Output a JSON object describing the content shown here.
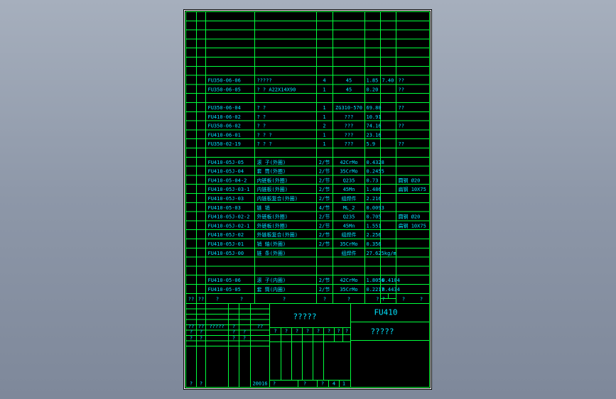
{
  "drawing": {
    "title_code": "FU410",
    "name_placeholder": "?????",
    "name_placeholder2": "?????",
    "year": "20016"
  },
  "rows": [
    {
      "code": "",
      "name": "",
      "qty": "",
      "material": "",
      "unit_weight": "",
      "total_weight": "",
      "note": ""
    },
    {
      "code": "",
      "name": "",
      "qty": "",
      "material": "",
      "unit_weight": "",
      "total_weight": "",
      "note": ""
    },
    {
      "code": "",
      "name": "",
      "qty": "",
      "material": "",
      "unit_weight": "",
      "total_weight": "",
      "note": ""
    },
    {
      "code": "",
      "name": "",
      "qty": "",
      "material": "",
      "unit_weight": "",
      "total_weight": "",
      "note": ""
    },
    {
      "code": "",
      "name": "",
      "qty": "",
      "material": "",
      "unit_weight": "",
      "total_weight": "",
      "note": ""
    },
    {
      "code": "",
      "name": "",
      "qty": "",
      "material": "",
      "unit_weight": "",
      "total_weight": "",
      "note": ""
    },
    {
      "code": "",
      "name": "",
      "qty": "",
      "material": "",
      "unit_weight": "",
      "total_weight": "",
      "note": ""
    },
    {
      "code": "FU350-06-06",
      "name": "?????",
      "qty": "4",
      "material": "45",
      "unit_weight": "1.85",
      "total_weight": "7.40",
      "note": "??"
    },
    {
      "code": "FU350-06-05",
      "name": "?  ?  A22X14X90",
      "qty": "1",
      "material": "45",
      "unit_weight": "0.20",
      "total_weight": "",
      "note": "??"
    },
    {
      "code": "",
      "name": "",
      "qty": "",
      "material": "",
      "unit_weight": "",
      "total_weight": "",
      "note": ""
    },
    {
      "code": "FU350-06-04",
      "name": "?      ?",
      "qty": "1",
      "material": "ZG310-570",
      "unit_weight": "69.80",
      "total_weight": "",
      "note": "??"
    },
    {
      "code": "FU410-06-02",
      "name": "?      ?",
      "qty": "1",
      "material": "???",
      "unit_weight": "10.91",
      "total_weight": "",
      "note": ""
    },
    {
      "code": "FU350-06-02",
      "name": "?      ?",
      "qty": "2",
      "material": "???",
      "unit_weight": "74.16",
      "total_weight": "",
      "note": "??"
    },
    {
      "code": "FU410-06-01",
      "name": "?   ?   ?",
      "qty": "1",
      "material": "???",
      "unit_weight": "23.16",
      "total_weight": "",
      "note": ""
    },
    {
      "code": "FU350-02-19",
      "name": "?   ?   ?",
      "qty": "1",
      "material": "???",
      "unit_weight": "5.9",
      "total_weight": "",
      "note": "??"
    },
    {
      "code": "",
      "name": "",
      "qty": "",
      "material": "",
      "unit_weight": "",
      "total_weight": "",
      "note": ""
    },
    {
      "code": "FU410-05J-05",
      "name": "滚 子(外圈)",
      "qty": "2/节",
      "material": "42CrMo",
      "unit_weight": "0.4328",
      "total_weight": "",
      "note": ""
    },
    {
      "code": "FU410-05J-04",
      "name": "套 筒(外圈)",
      "qty": "2/节",
      "material": "35CrMo",
      "unit_weight": "0.2455",
      "total_weight": "",
      "note": ""
    },
    {
      "code": "FU410-05-04-2",
      "name": "内链板(外圈)",
      "qty": "2/节",
      "material": "Q235",
      "unit_weight": "0.73",
      "total_weight": "",
      "note": "圆钢 Ø20"
    },
    {
      "code": "FU410-05J-03-1",
      "name": "内链板(外圈)",
      "qty": "2/节",
      "material": "45Mn",
      "unit_weight": "1.486",
      "total_weight": "",
      "note": "扁钢 10X75"
    },
    {
      "code": "FU410-05J-03",
      "name": "内链板复合(外圈)",
      "qty": "2/节",
      "material": "组焊件",
      "unit_weight": "2.216",
      "total_weight": "",
      "note": ""
    },
    {
      "code": "FU410-05-03",
      "name": "链 销",
      "qty": "4/节",
      "material": "ML_2",
      "unit_weight": "0.0093",
      "total_weight": "",
      "note": ""
    },
    {
      "code": "FU410-05J-02-2",
      "name": "外链板(外圈)",
      "qty": "2/节",
      "material": "Q235",
      "unit_weight": "0.705",
      "total_weight": "",
      "note": "圆钢 Ø20"
    },
    {
      "code": "FU410-05J-02-1",
      "name": "外链板(外圈)",
      "qty": "2/节",
      "material": "45Mn",
      "unit_weight": "1.551",
      "total_weight": "",
      "note": "扁钢 10X75"
    },
    {
      "code": "FU410-05J-02",
      "name": "外链板复合(外圈)",
      "qty": "2/节",
      "material": "组焊件",
      "unit_weight": "2.256",
      "total_weight": "",
      "note": ""
    },
    {
      "code": "FU410-05J-01",
      "name": "销 轴(外圈)",
      "qty": "2/节",
      "material": "35CrMo",
      "unit_weight": "0.356",
      "total_weight": "",
      "note": ""
    },
    {
      "code": "FU410-05J-00",
      "name": "链 条(外圈)",
      "qty": "",
      "material": "组焊件",
      "unit_weight": "27.625kg/m",
      "total_weight": "",
      "note": ""
    },
    {
      "code": "",
      "name": "",
      "qty": "",
      "material": "",
      "unit_weight": "",
      "total_weight": "",
      "note": ""
    },
    {
      "code": "",
      "name": "",
      "qty": "",
      "material": "",
      "unit_weight": "",
      "total_weight": "",
      "note": ""
    },
    {
      "code": "FU410-05-06",
      "name": "滚 子(内圈)",
      "qty": "2/节",
      "material": "42CrMo",
      "unit_weight": "1.8056",
      "total_weight": "0.4104",
      "note": ""
    },
    {
      "code": "FU410-05-05",
      "name": "套 筒(内圈)",
      "qty": "2/节",
      "material": "35CrMo",
      "unit_weight": "0.2217",
      "total_weight": "0.4434",
      "note": ""
    }
  ],
  "header_row": {
    "c0": "??",
    "c1": "??",
    "c2": "?",
    "c3": "?",
    "c4": "?",
    "c5": "?",
    "c6": "?",
    "c7": "? ?",
    "c8": "?",
    "c9": "?"
  },
  "title_block": {
    "r1": [
      "??",
      "??",
      "?????",
      "?",
      "??"
    ],
    "r2": [
      "?",
      "?",
      "?",
      "?",
      "?"
    ],
    "r3": [
      "?",
      "?",
      "?",
      "?"
    ],
    "r4": [
      "?",
      "?",
      "20016",
      "?",
      "?",
      "?",
      "4",
      "1"
    ],
    "scale_row": [
      "?",
      "?",
      "?",
      "?",
      "?",
      "?",
      "?",
      "?"
    ]
  }
}
